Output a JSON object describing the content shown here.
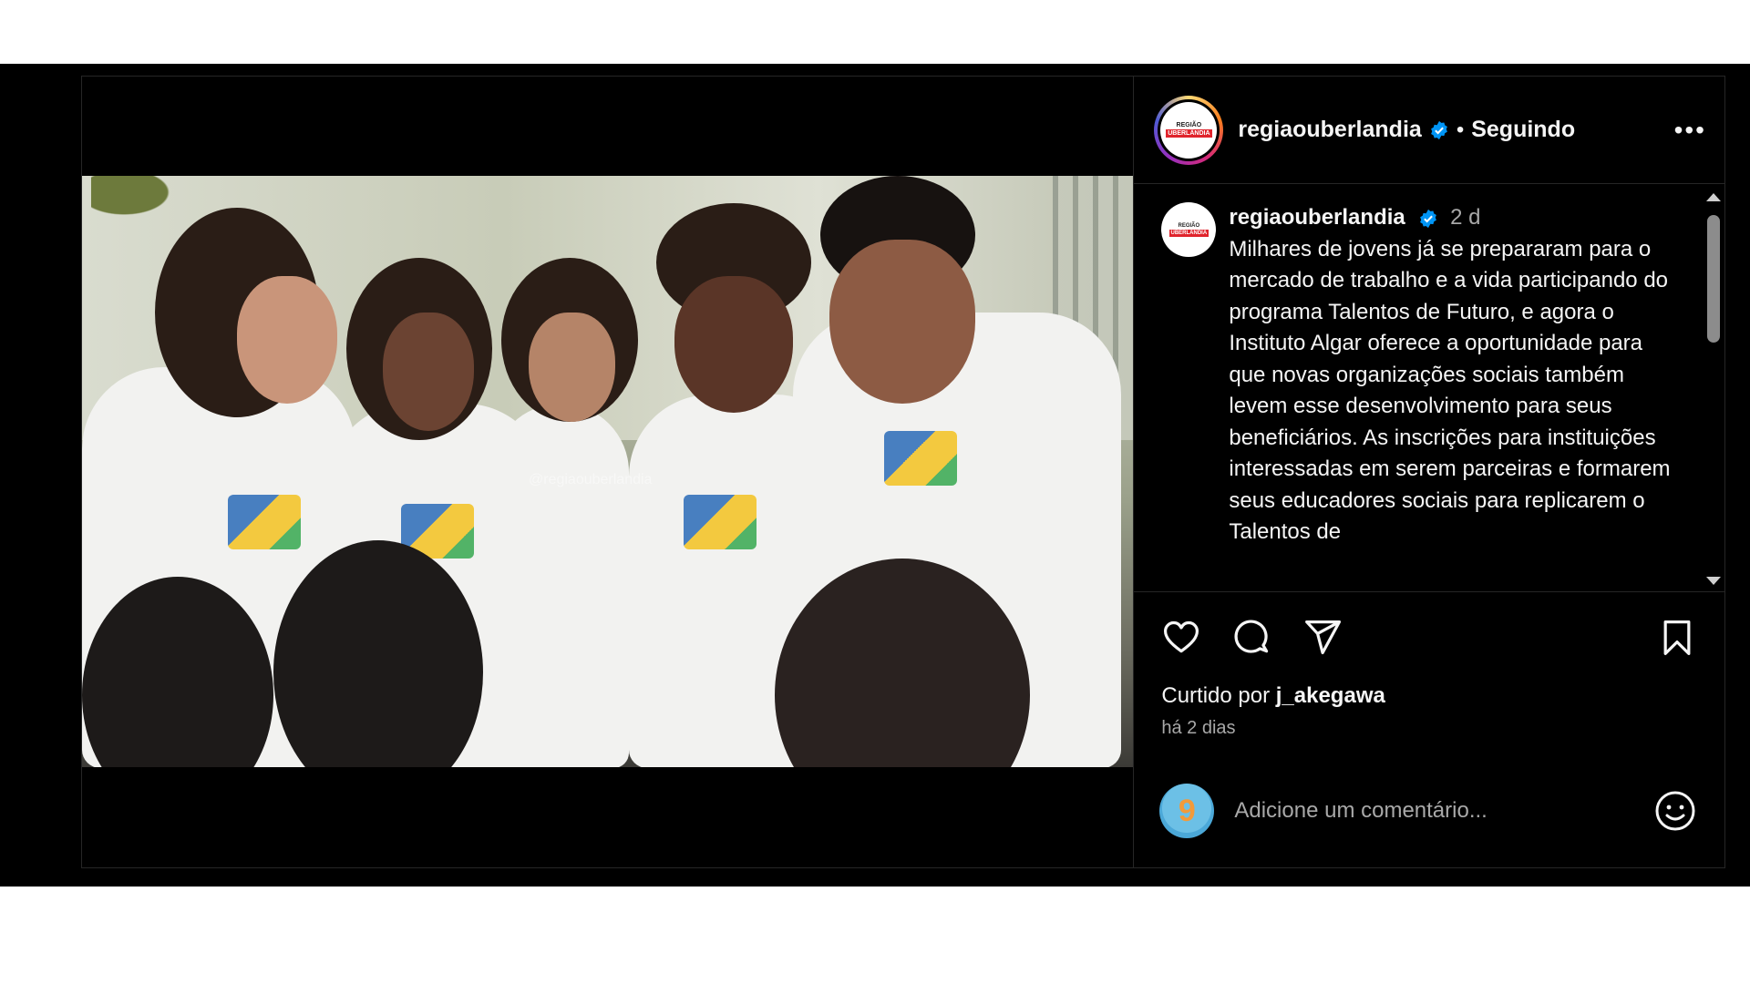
{
  "header": {
    "username": "regiaouberlandia",
    "separator": "•",
    "follow_state": "Seguindo",
    "more": "•••",
    "avatar_line1": "REGIÃO",
    "avatar_line2": "UBERLÂNDIA"
  },
  "caption": {
    "username": "regiaouberlandia",
    "time": "2 d",
    "text": "Milhares de jovens já se prepararam para o mercado de trabalho e a vida participando do programa Talentos de Futuro, e agora o Instituto Algar oferece a oportunidade para que novas organizações sociais também levem esse desenvolvimento para seus beneficiários. As inscrições para instituições interessadas em serem parceiras e formarem seus educadores sociais para replicarem o Talentos de"
  },
  "media": {
    "watermark": "@regiaouberlandia"
  },
  "likes": {
    "prefix": "Curtido por ",
    "user": "j_akegawa"
  },
  "timestamp": "há 2 dias",
  "comment": {
    "placeholder": "Adicione um comentário...",
    "avatar_glyph": "9"
  },
  "colors": {
    "background": "#000000",
    "verified": "#0095f6",
    "text": "#f5f5f5",
    "muted": "#a8a8a8"
  }
}
